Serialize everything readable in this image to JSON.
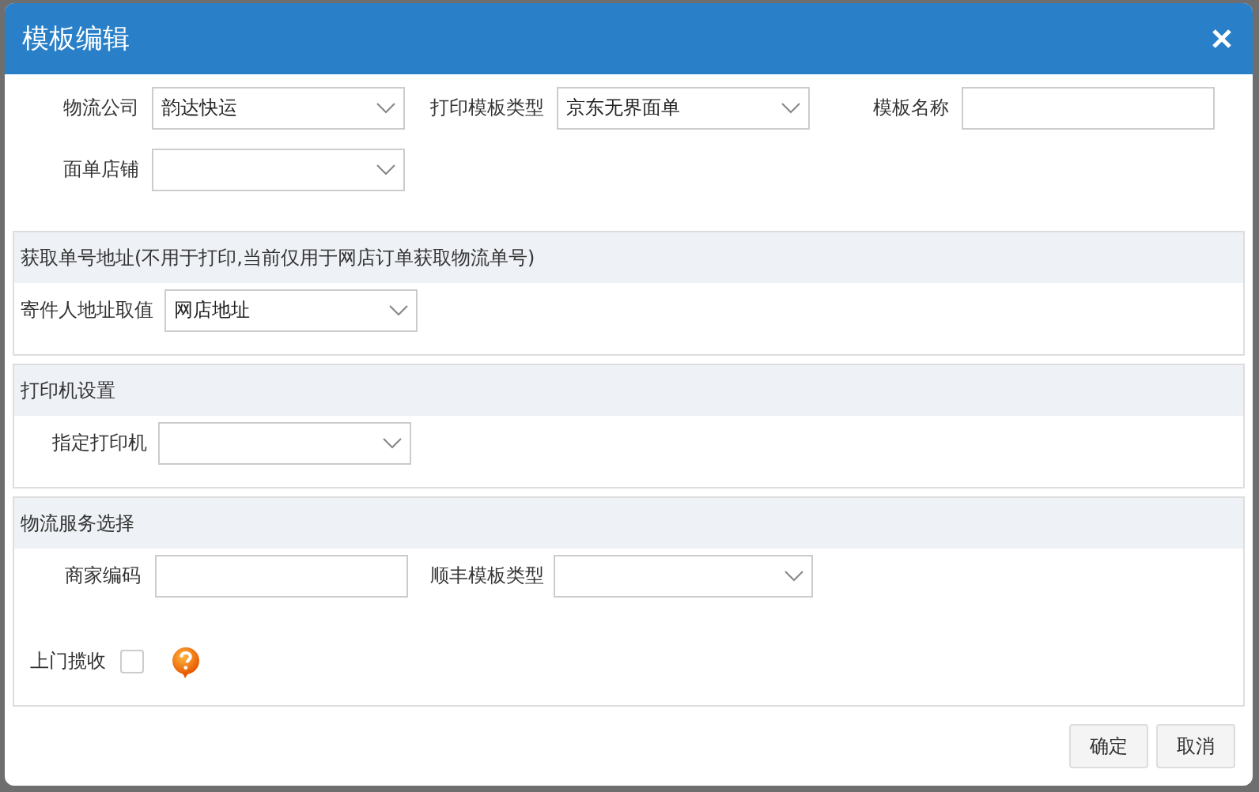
{
  "dialog": {
    "title": "模板编辑",
    "top_rows": [
      {
        "fields": [
          {
            "label": "物流公司",
            "kind": "select",
            "value": "韵达快运"
          },
          {
            "label": "打印模板类型",
            "kind": "select",
            "value": "京东无界面单"
          },
          {
            "label": "模板名称",
            "kind": "input"
          }
        ]
      },
      {
        "fields": [
          {
            "label": "面单店铺",
            "kind": "select"
          }
        ]
      }
    ],
    "sections": [
      {
        "title": "获取单号地址(不用于打印,当前仅用于网店订单获取物流单号)",
        "rows": [
          {
            "fields": [
              {
                "label": "寄件人地址取值",
                "kind": "select",
                "value": "网店地址"
              }
            ]
          }
        ]
      },
      {
        "title": "打印机设置",
        "rows": [
          {
            "fields": [
              {
                "label": "指定打印机",
                "kind": "select"
              }
            ]
          }
        ]
      },
      {
        "title": "物流服务选择",
        "rows": [
          {
            "fields": [
              {
                "label": "商家编码",
                "kind": "input"
              },
              {
                "label": "顺丰模板类型",
                "kind": "select"
              }
            ]
          },
          {
            "fields": [
              {
                "label": "上门揽收",
                "kind": "checkbox",
                "checked": false,
                "help": true
              }
            ]
          }
        ]
      }
    ],
    "buttons": [
      {
        "label": "确定"
      },
      {
        "label": "取消"
      }
    ]
  }
}
